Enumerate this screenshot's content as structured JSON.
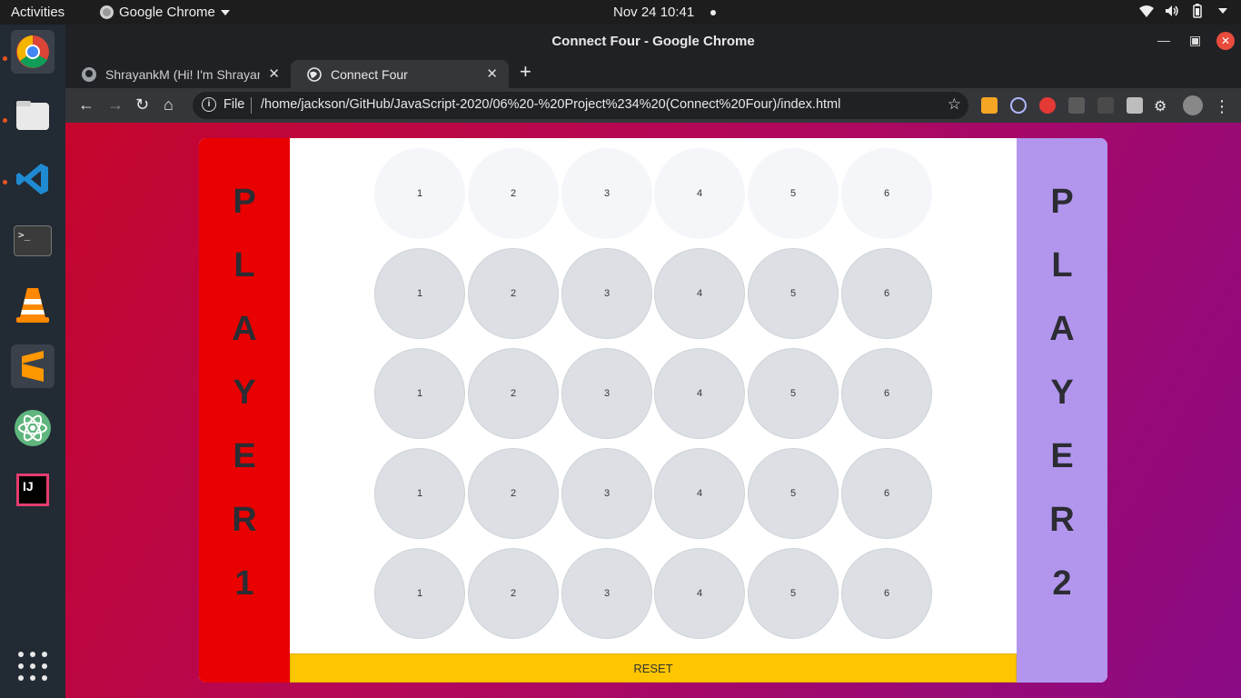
{
  "system": {
    "activities": "Activities",
    "app_menu": "Google Chrome",
    "clock": "Nov 24  10:41"
  },
  "window": {
    "title": "Connect Four - Google Chrome"
  },
  "tabs": [
    {
      "label": "ShrayankM (Hi! I'm Shrayank",
      "active": false
    },
    {
      "label": "Connect Four",
      "active": true
    }
  ],
  "omnibox": {
    "scheme_label": "File",
    "url": "/home/jackson/GitHub/JavaScript-2020/06%20-%20Project%234%20(Connect%20Four)/index.html"
  },
  "game": {
    "player1": {
      "letters": [
        "P",
        "L",
        "A",
        "Y",
        "E",
        "R",
        "1"
      ],
      "color": "#e90000"
    },
    "player2": {
      "letters": [
        "P",
        "L",
        "A",
        "Y",
        "E",
        "R",
        "2"
      ],
      "color": "#b296ee"
    },
    "top_row": [
      "1",
      "2",
      "3",
      "4",
      "5",
      "6"
    ],
    "rows": [
      [
        "1",
        "2",
        "3",
        "4",
        "5",
        "6"
      ],
      [
        "1",
        "2",
        "3",
        "4",
        "5",
        "6"
      ],
      [
        "1",
        "2",
        "3",
        "4",
        "5",
        "6"
      ],
      [
        "1",
        "2",
        "3",
        "4",
        "5",
        "6"
      ]
    ],
    "reset_label": "RESET",
    "reset_color": "#fdc600"
  },
  "dock_icons": [
    "chrome-icon",
    "files-icon",
    "vscode-icon",
    "terminal-icon",
    "vlc-icon",
    "sublime-icon",
    "atom-icon",
    "intellij-icon",
    "show-apps-icon"
  ]
}
